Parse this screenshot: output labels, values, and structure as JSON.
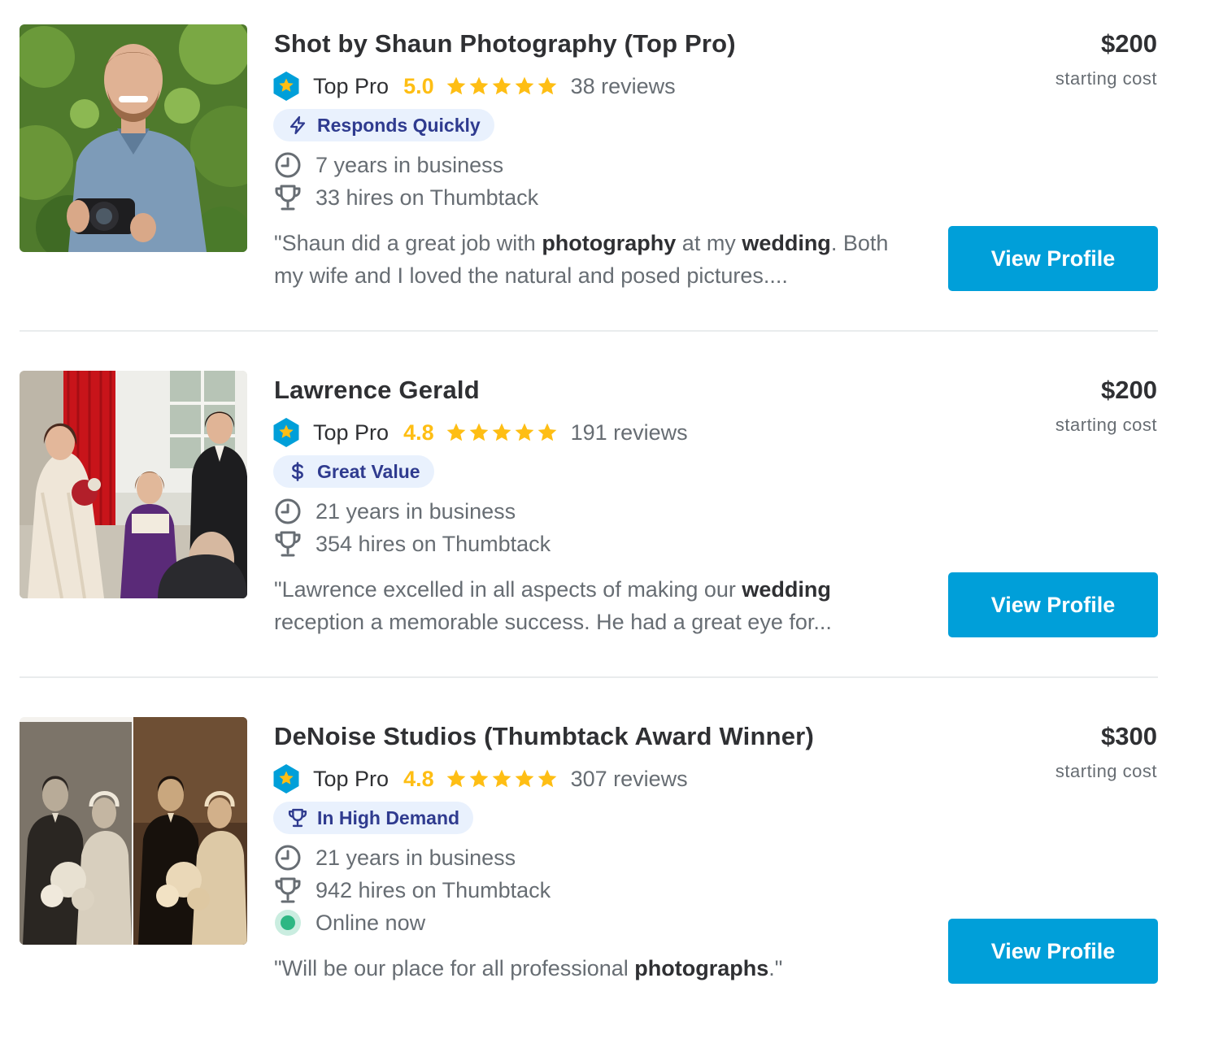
{
  "pros": [
    {
      "name": "Shot by Shaun Photography (Top Pro)",
      "top_pro_label": "Top Pro",
      "rating": "5.0",
      "stars": 5,
      "reviews": "38 reviews",
      "badge": {
        "label": "Responds Quickly",
        "icon": "lightning-icon"
      },
      "years": "7 years in business",
      "hires": "33 hires on Thumbtack",
      "quote": {
        "open": "\"Shaun did a great job with ",
        "kw1": "photography",
        "mid": " at my ",
        "kw2": "wedding",
        "rest": ". Both my wife and I loved the natural and posed pictures...."
      },
      "price": "$200",
      "price_label": "starting cost",
      "button": "View Profile"
    },
    {
      "name": "Lawrence Gerald",
      "top_pro_label": "Top Pro",
      "rating": "4.8",
      "stars": 5,
      "reviews": "191 reviews",
      "badge": {
        "label": "Great Value",
        "icon": "dollar-icon"
      },
      "years": "21 years in business",
      "hires": "354 hires on Thumbtack",
      "quote": {
        "open": "\"Lawrence excelled in all aspects of making our ",
        "kw1": "wedding",
        "rest": " reception a memorable success. He had a great eye for..."
      },
      "price": "$200",
      "price_label": "starting cost",
      "button": "View Profile"
    },
    {
      "name": "DeNoise Studios (Thumbtack Award Winner)",
      "top_pro_label": "Top Pro",
      "rating": "4.8",
      "stars": 5,
      "reviews": "307 reviews",
      "badge": {
        "label": "In High Demand",
        "icon": "trophy-icon"
      },
      "years": "21 years in business",
      "hires": "942 hires on Thumbtack",
      "online": "Online now",
      "quote": {
        "open": "\"Will be our place for all professional ",
        "kw1": "photographs",
        "rest": ".\""
      },
      "price": "$300",
      "price_label": "starting cost",
      "button": "View Profile"
    }
  ],
  "colors": {
    "accent_button": "#009fd9",
    "rating": "#febe14",
    "badge_bg": "#e9f1fd",
    "badge_text": "#2f3b8f",
    "online": "#2db783",
    "top_pro_hex": "#009fd9"
  }
}
